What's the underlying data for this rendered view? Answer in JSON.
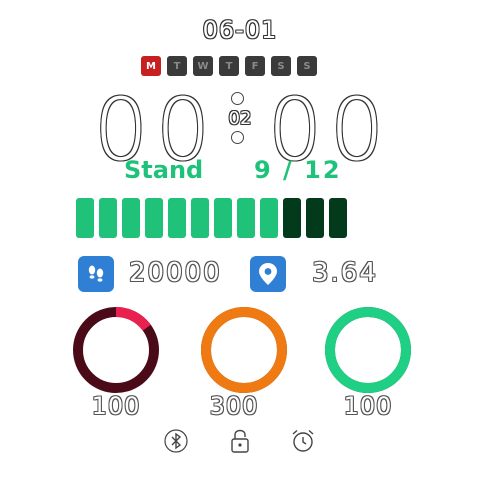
{
  "date": "06-01",
  "weekdays": [
    {
      "label": "M",
      "active": true
    },
    {
      "label": "T",
      "active": false
    },
    {
      "label": "W",
      "active": false
    },
    {
      "label": "T",
      "active": false
    },
    {
      "label": "F",
      "active": false
    },
    {
      "label": "S",
      "active": false
    },
    {
      "label": "S",
      "active": false
    }
  ],
  "time": {
    "h1": "0",
    "h2": "0",
    "m1": "0",
    "m2": "0",
    "seconds": "02"
  },
  "stand": {
    "label": "Stand",
    "value": "9 / 12",
    "achieved": 9,
    "goal": 12
  },
  "steps": {
    "icon": "footsteps-icon",
    "value": "20000"
  },
  "distance": {
    "icon": "location-pin-icon",
    "value": "3.64"
  },
  "rings": {
    "heart": {
      "icon": "heart-icon",
      "value": "100",
      "progress": 0.15,
      "color": "#e8214f",
      "track": "#4a0a18"
    },
    "fire": {
      "icon": "flame-icon",
      "value": "300",
      "progress": 1.0,
      "color": "#f07a12",
      "track": "#5a2a05"
    },
    "battery": {
      "icon": "battery-icon",
      "value": "100",
      "progress": 1.0,
      "color": "#1fcf84",
      "track": "#063b22"
    }
  },
  "colors": {
    "accent": "#1ec27a",
    "stand_on": "#20c27a",
    "stand_off": "#033a1c",
    "icon_bg": "#2f7fd4",
    "weekday_active": "#c62020"
  },
  "system_icons": [
    "bluetooth-icon",
    "lock-icon",
    "alarm-icon"
  ]
}
